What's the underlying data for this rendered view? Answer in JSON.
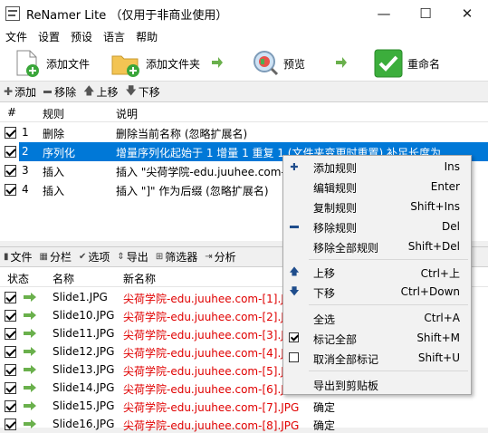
{
  "window": {
    "title": "ReNamer Lite （仅用于非商业使用）",
    "minimize": "—",
    "maximize": "☐",
    "close": "✕"
  },
  "menu": [
    "文件",
    "设置",
    "预设",
    "语言",
    "帮助"
  ],
  "toolbar": {
    "add_files": "添加文件",
    "add_folder": "添加文件夹",
    "preview": "预览",
    "rename": "重命名"
  },
  "rules_toolbar": {
    "add": "添加",
    "remove": "移除",
    "up": "上移",
    "down": "下移"
  },
  "rules": {
    "headers": {
      "num": "#",
      "rule": "规则",
      "desc": "说明"
    },
    "rows": [
      {
        "num": "1",
        "rule": "删除",
        "desc": "删除当前名称 (忽略扩展名)",
        "checked": true,
        "selected": false
      },
      {
        "num": "2",
        "rule": "序列化",
        "desc": "增量序列化起始于 1 增量 1 重复 1 (文件夹变更时重置) 补足长度为",
        "checked": true,
        "selected": true
      },
      {
        "num": "3",
        "rule": "插入",
        "desc": "插入 \"尖荷学院-edu.juuhee.com-",
        "checked": true,
        "selected": false
      },
      {
        "num": "4",
        "rule": "插入",
        "desc": "插入 \"]\" 作为后缀 (忽略扩展名)",
        "checked": true,
        "selected": false
      }
    ]
  },
  "tabs": {
    "files": "文件",
    "columns": "分栏",
    "options": "选项",
    "export": "导出",
    "filters": "筛选器",
    "analyze": "分析"
  },
  "files": {
    "headers": {
      "state": "状态",
      "name": "名称",
      "new_name": "新名称"
    },
    "rows": [
      {
        "name": "Slide1.JPG",
        "new_name": "尖荷学院-edu.juuhee.com-[1].JPG",
        "status": ""
      },
      {
        "name": "Slide10.JPG",
        "new_name": "尖荷学院-edu.juuhee.com-[2].JPG",
        "status": ""
      },
      {
        "name": "Slide11.JPG",
        "new_name": "尖荷学院-edu.juuhee.com-[3].JPG",
        "status": ""
      },
      {
        "name": "Slide12.JPG",
        "new_name": "尖荷学院-edu.juuhee.com-[4].JPG",
        "status": ""
      },
      {
        "name": "Slide13.JPG",
        "new_name": "尖荷学院-edu.juuhee.com-[5].JPG",
        "status": ""
      },
      {
        "name": "Slide14.JPG",
        "new_name": "尖荷学院-edu.juuhee.com-[6].JPG",
        "status": ""
      },
      {
        "name": "Slide15.JPG",
        "new_name": "尖荷学院-edu.juuhee.com-[7].JPG",
        "status": "确定"
      },
      {
        "name": "Slide16.JPG",
        "new_name": "尖荷学院-edu.juuhee.com-[8].JPG",
        "status": "确定"
      }
    ]
  },
  "context_menu": {
    "items": [
      {
        "label": "添加规则",
        "key": "Ins"
      },
      {
        "label": "编辑规则",
        "key": "Enter"
      },
      {
        "label": "复制规则",
        "key": "Shift+Ins"
      },
      {
        "label": "移除规则",
        "key": "Del"
      },
      {
        "label": "移除全部规则",
        "key": "Shift+Del"
      },
      {
        "label": "上移",
        "key": "Ctrl+上"
      },
      {
        "label": "下移",
        "key": "Ctrl+Down"
      },
      {
        "label": "全选",
        "key": "Ctrl+A"
      },
      {
        "label": "标记全部",
        "key": "Shift+M"
      },
      {
        "label": "取消全部标记",
        "key": "Shift+U"
      },
      {
        "label": "导出到剪贴板",
        "key": ""
      }
    ]
  },
  "colors": {
    "selection": "#0078d7",
    "new_name": "#e00000",
    "arrow": "#2fa52f"
  }
}
